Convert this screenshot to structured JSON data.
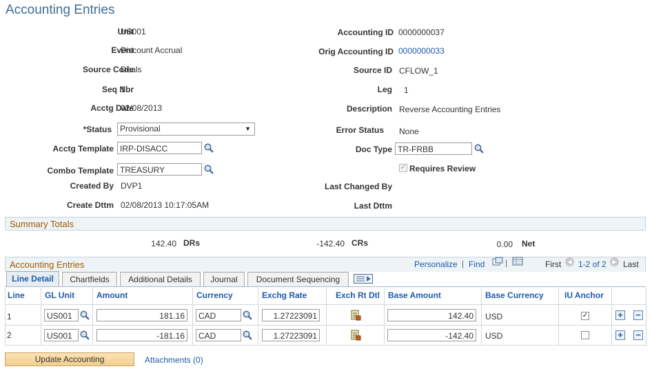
{
  "page": {
    "title": "Accounting Entries"
  },
  "form": {
    "unit_label": "Unit",
    "unit": "US001",
    "accounting_id_label": "Accounting ID",
    "accounting_id": "0000000037",
    "event_label": "Event",
    "event": "Discount Accrual",
    "orig_accounting_id_label": "Orig Accounting ID",
    "orig_accounting_id": "0000000033",
    "source_code_label": "Source Code",
    "source_code": "Deals",
    "source_id_label": "Source ID",
    "source_id": "CFLOW_1",
    "seq_nbr_label": "Seq Nbr",
    "seq_nbr": "1",
    "leg_label": "Leg",
    "leg": "1",
    "acctg_date_label": "Acctg Date",
    "acctg_date": "02/08/2013",
    "description_label": "Description",
    "description": "Reverse Accounting Entries",
    "status_label": "*Status",
    "status": "Provisional",
    "error_status_label": "Error Status",
    "error_status": "None",
    "acctg_template_label": "Acctg Template",
    "acctg_template": "IRP-DISACC",
    "doc_type_label": "Doc Type",
    "doc_type": "TR-FRBB",
    "combo_template_label": "Combo Template",
    "combo_template": "TREASURY",
    "requires_review_label": "Requires Review",
    "requires_review": true,
    "created_by_label": "Created By",
    "created_by": "DVP1",
    "last_changed_by_label": "Last Changed By",
    "last_changed_by": "",
    "create_dttm_label": "Create Dttm",
    "create_dttm": "02/08/2013 10:17:05AM",
    "last_dttm_label": "Last Dttm",
    "last_dttm": ""
  },
  "summary": {
    "title": "Summary Totals",
    "drs_value": "142.40",
    "drs_label": "DRs",
    "crs_value": "-142.40",
    "crs_label": "CRs",
    "net_value": "0.00",
    "net_label": "Net"
  },
  "grid": {
    "title": "Accounting Entries",
    "personalize": "Personalize",
    "separator": "|",
    "find": "Find",
    "first": "First",
    "range": "1-2 of 2",
    "last": "Last",
    "tabs": [
      "Line Detail",
      "Chartfields",
      "Additional Details",
      "Journal",
      "Document Sequencing"
    ],
    "columns": [
      "Line",
      "GL Unit",
      "Amount",
      "Currency",
      "Exchg Rate",
      "Exch Rt Dtl",
      "Base Amount",
      "Base Currency",
      "IU Anchor"
    ],
    "rows": [
      {
        "line": "1",
        "gl_unit": "US001",
        "amount": "181.16",
        "currency": "CAD",
        "exchg_rate": "1.27223091",
        "base_amount": "142.40",
        "base_currency": "USD",
        "iu_anchor": true
      },
      {
        "line": "2",
        "gl_unit": "US001",
        "amount": "-181.16",
        "currency": "CAD",
        "exchg_rate": "1.27223091",
        "base_amount": "-142.40",
        "base_currency": "USD",
        "iu_anchor": false
      }
    ]
  },
  "footer": {
    "update_button": "Update Accounting",
    "attachments": "Attachments (0)"
  },
  "colors": {
    "title": "#3e6d93",
    "link": "#1e5aa8",
    "section_text": "#a05a00",
    "button": "#f3cf8e"
  }
}
